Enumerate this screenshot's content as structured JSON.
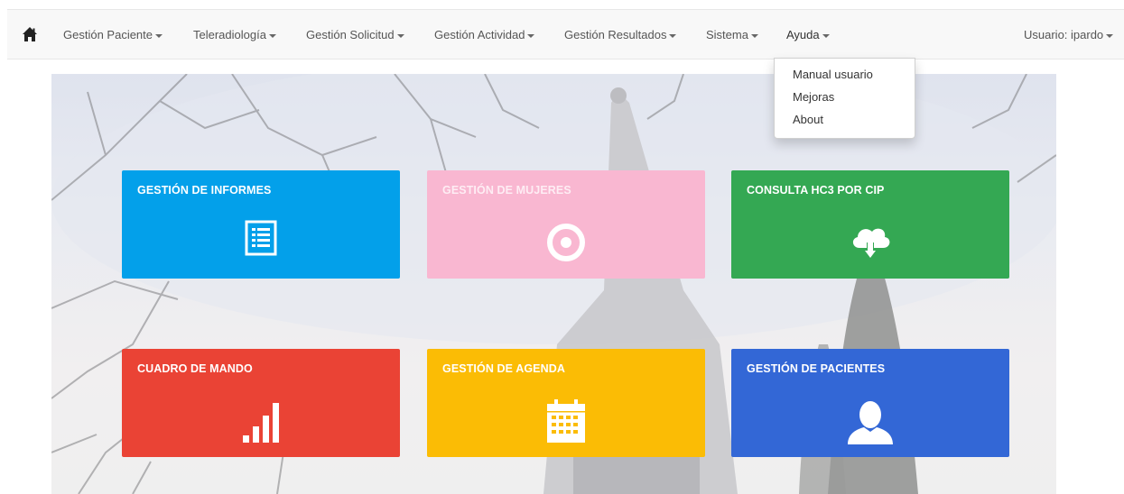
{
  "navbar": {
    "home_icon": "home-icon",
    "items": [
      {
        "label": "Gestión Paciente",
        "dropdown": true
      },
      {
        "label": "Teleradiología",
        "dropdown": true
      },
      {
        "label": "Gestión Solicitud",
        "dropdown": true
      },
      {
        "label": "Gestión Actividad",
        "dropdown": true
      },
      {
        "label": "Gestión Resultados",
        "dropdown": true
      },
      {
        "label": "Sistema",
        "dropdown": true
      },
      {
        "label": "Ayuda",
        "dropdown": true,
        "open": true
      }
    ],
    "user_label": "Usuario: ipardo"
  },
  "help_menu": {
    "items": [
      {
        "label": "Manual usuario"
      },
      {
        "label": "Mejoras"
      },
      {
        "label": "About"
      }
    ]
  },
  "tiles": [
    {
      "title": "GESTIÓN DE INFORMES",
      "color": "#03a0ea",
      "icon": "list-icon"
    },
    {
      "title": "GESTIÓN DE MUJERES",
      "color": "#f9b7d1",
      "icon": "target-icon"
    },
    {
      "title": "CONSULTA HC3 POR CIP",
      "color": "#34a853",
      "icon": "cloud-download-icon"
    },
    {
      "title": "CUADRO DE MANDO",
      "color": "#ea4335",
      "icon": "signal-bars-icon"
    },
    {
      "title": "GESTIÓN DE AGENDA",
      "color": "#fbbc05",
      "icon": "calendar-icon"
    },
    {
      "title": "GESTIÓN DE PACIENTES",
      "color": "#3367d6",
      "icon": "user-icon"
    }
  ]
}
